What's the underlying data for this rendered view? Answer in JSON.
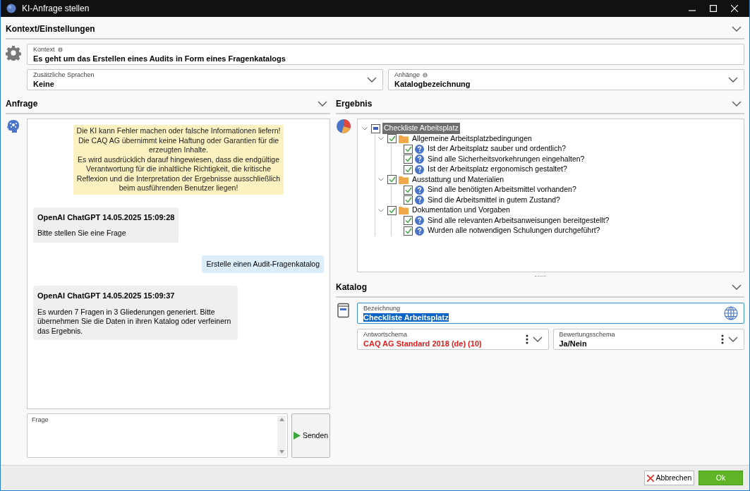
{
  "window": {
    "title": "KI-Anfrage stellen"
  },
  "context_section": {
    "title": "Kontext/Einstellungen",
    "expanded": true,
    "context_field": {
      "label": "Kontext",
      "value": "Es geht um das Erstellen eines Audits in Form eines Fragenkatalogs"
    },
    "languages_field": {
      "label": "Zusätzliche Sprachen",
      "value": "Keine"
    },
    "attachments_field": {
      "label": "Anhänge",
      "value": "Katalogbezeichnung"
    }
  },
  "request_section": {
    "title": "Anfrage",
    "expanded": true,
    "notice": "Die KI kann Fehler machen oder falsche Informationen liefern!\nDie CAQ AG übernimmt keine Haftung oder Garantien für die erzeugten Inhalte.\nEs wird ausdrücklich darauf hingewiesen, dass die endgültige Verantwortung für die inhaltliche Richtigkeit, die kritische Reflexion und die Interpretation der Ergebnisse ausschließlich beim ausführenden Benutzer liegen!",
    "messages": [
      {
        "kind": "assistant",
        "header": "OpenAI ChatGPT 14.05.2025 15:09:28",
        "text": "Bitte stellen Sie eine Frage"
      },
      {
        "kind": "user",
        "text": "Erstelle einen Audit-Fragenkatalog"
      },
      {
        "kind": "assistant",
        "header": "OpenAI ChatGPT 14.05.2025 15:09:37",
        "text": "Es wurden 7 Fragen in 3 Gliederungen generiert. Bitte übernehmen Sie die Daten in ihren Katalog oder verfeinern das Ergebnis."
      }
    ],
    "question_field": {
      "label": "Frage"
    },
    "send_button": "Senden"
  },
  "result_section": {
    "title": "Ergebnis",
    "expanded": true,
    "tree": [
      {
        "kind": "root",
        "label": "Checkliste Arbeitsplatz",
        "checked": false,
        "indeterminate": true,
        "selected": true,
        "expanded": true,
        "children": [
          {
            "kind": "folder",
            "label": "Allgemeine Arbeitsplatzbedingungen",
            "checked": true,
            "indeterminate": false,
            "selected": false,
            "expanded": true,
            "children": [
              {
                "kind": "question",
                "label": "Ist der Arbeitsplatz sauber und ordentlich?",
                "checked": true,
                "indeterminate": false,
                "selected": false
              },
              {
                "kind": "question",
                "label": "Sind alle Sicherheitsvorkehrungen eingehalten?",
                "checked": true,
                "indeterminate": false,
                "selected": false
              },
              {
                "kind": "question",
                "label": "Ist der Arbeitsplatz ergonomisch gestaltet?",
                "checked": true,
                "indeterminate": false,
                "selected": false
              }
            ]
          },
          {
            "kind": "folder",
            "label": "Ausstattung und Materialien",
            "checked": true,
            "indeterminate": false,
            "selected": false,
            "expanded": true,
            "children": [
              {
                "kind": "question",
                "label": "Sind alle benötigten Arbeitsmittel vorhanden?",
                "checked": true,
                "indeterminate": false,
                "selected": false
              },
              {
                "kind": "question",
                "label": "Sind die Arbeitsmittel in gutem Zustand?",
                "checked": true,
                "indeterminate": false,
                "selected": false
              }
            ]
          },
          {
            "kind": "folder",
            "label": "Dokumentation und Vorgaben",
            "checked": true,
            "indeterminate": false,
            "selected": false,
            "expanded": true,
            "children": [
              {
                "kind": "question",
                "label": "Sind alle relevanten Arbeitsanweisungen bereitgestellt?",
                "checked": true,
                "indeterminate": false,
                "selected": false
              },
              {
                "kind": "question",
                "label": "Wurden alle notwendigen Schulungen durchgeführt?",
                "checked": true,
                "indeterminate": false,
                "selected": false
              }
            ]
          }
        ]
      }
    ]
  },
  "catalog_section": {
    "title": "Katalog",
    "expanded": true,
    "name_field": {
      "label": "Bezeichnung",
      "value": "Checkliste Arbeitsplatz"
    },
    "answer_scheme_field": {
      "label": "Antwortschema",
      "value": "CAQ AG Standard 2018 (de) (10)",
      "error": true
    },
    "rating_scheme_field": {
      "label": "Bewertungsschema",
      "value": "Ja/Nein",
      "error": false
    }
  },
  "footer": {
    "cancel_button": "Abbrechen",
    "ok_button": "Ok"
  }
}
